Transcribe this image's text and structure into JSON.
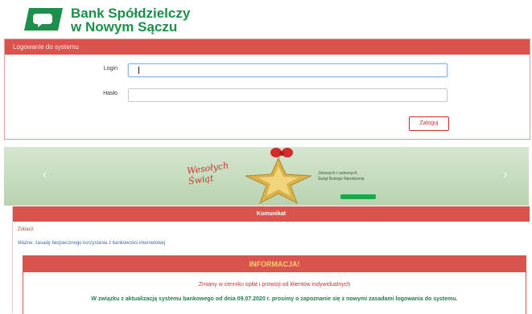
{
  "header": {
    "brand_line1": "Bank Spółdzielczy",
    "brand_line2": "w Nowym Sączu",
    "brand_color": "#1c8f4a"
  },
  "login": {
    "panel_title": "Logowanie do systemu",
    "login_label": "Login",
    "password_label": "Hasło",
    "submit_label": "Zaloguj",
    "accent_color": "#d9534f"
  },
  "banner": {
    "greeting_line1": "Wesołych",
    "greeting_line2": "Świąt",
    "text_line1": "Zdrowych i radosnych",
    "text_line2": "Świąt Bożego Narodzenia",
    "prev_icon": "chevron-left-icon",
    "next_icon": "chevron-right-icon"
  },
  "content": {
    "section_title": "Komunikat",
    "link1": "Zobacz",
    "link2": "Ważne: zasady bezpiecznego korzystania z bankowości internetowej",
    "info_title": "INFORMACJA!",
    "info_red": "Zmiany w cenniku opłat i prowizji od klientów indywidualnych",
    "info_green": "W związku z aktualizacją systemu bankowego od dnia 09.07.2020 r. prosimy o zapoznanie się z nowymi zasadami logowania do systemu."
  }
}
